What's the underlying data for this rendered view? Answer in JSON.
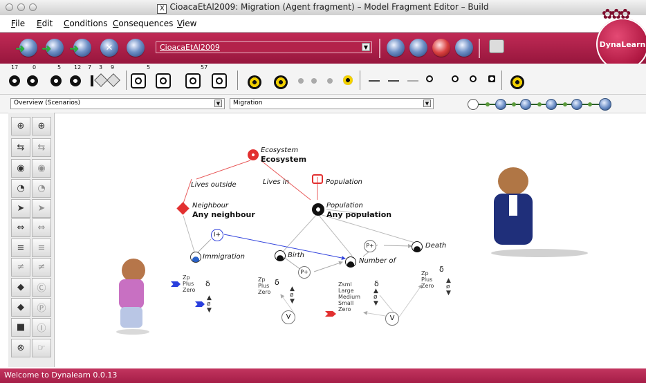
{
  "window": {
    "title": "CioacaEtAl2009: Migration (Agent fragment)  – Model Fragment Editor – Build",
    "title_icon": "X"
  },
  "menu": [
    "File",
    "Edit",
    "Conditions",
    "Consequences",
    "View"
  ],
  "red_toolbar": {
    "model_name": "CioacaEtAl2009",
    "logo_text": "DynaLearn"
  },
  "icon_toolbar": {
    "counts": [
      "17",
      "0",
      "5",
      "12",
      "7",
      "3",
      "9",
      "5",
      "57"
    ]
  },
  "selectors": {
    "left": "Overview (Scenarios)",
    "right": "Migration"
  },
  "diagram": {
    "ecosystem_type": "Ecosystem",
    "ecosystem_name": "Ecosystem",
    "rel_lives_outside": "Lives outside",
    "rel_lives_in": "Lives in",
    "population_type_top": "Population",
    "neighbour_type": "Neighbour",
    "neighbour_name": "Any neighbour",
    "population_type": "Population",
    "population_name": "Any population",
    "i_plus": "I+",
    "p_plus_1": "P+",
    "p_plus_2": "P+",
    "immigration": "Immigration",
    "birth": "Birth",
    "number_of": "Number of",
    "death": "Death",
    "v1": "V",
    "v2": "V",
    "delta": "δ",
    "zp_plus_zero": "Zp\nPlus\nZero",
    "zsml": "Zsml\nLarge\nMedium\nSmall\nZero",
    "zp_label": "Zp",
    "plus_label": "Plus",
    "zero_label": "Zero",
    "zsml_label": "Zsml",
    "large_label": "Large",
    "medium_label": "Medium",
    "small_label": "Small"
  },
  "status": "Welcome to Dynalearn 0.0.13"
}
